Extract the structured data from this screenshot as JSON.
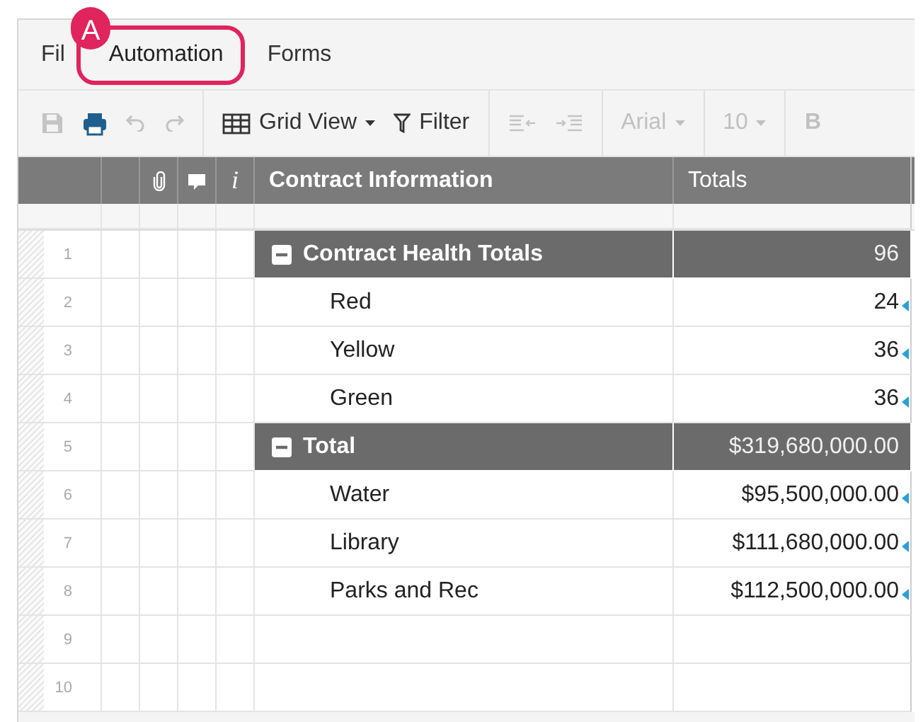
{
  "menu": [
    {
      "label": "Fil",
      "highlighted": false
    },
    {
      "label": "Automation",
      "highlighted": true
    },
    {
      "label": "Forms",
      "highlighted": false
    }
  ],
  "callout": {
    "badge": "A"
  },
  "toolbar": [
    {
      "kind": "save",
      "disabled": true
    },
    {
      "kind": "print",
      "disabled": false
    },
    {
      "kind": "undo",
      "disabled": true
    },
    {
      "kind": "redo",
      "disabled": true
    },
    {
      "kind": "sep"
    },
    {
      "kind": "grid",
      "label": "Grid View",
      "dropdown": true,
      "disabled": false
    },
    {
      "kind": "filter",
      "label": "Filter",
      "disabled": false
    },
    {
      "kind": "sep"
    },
    {
      "kind": "outdent",
      "disabled": true
    },
    {
      "kind": "indent",
      "disabled": true
    },
    {
      "kind": "sep"
    },
    {
      "kind": "text",
      "label": "Arial",
      "dropdown": true,
      "disabled": true
    },
    {
      "kind": "sep"
    },
    {
      "kind": "text",
      "label": "10",
      "dropdown": true,
      "disabled": true
    },
    {
      "kind": "sep"
    },
    {
      "kind": "bold",
      "label": "B",
      "disabled": true
    }
  ],
  "table": {
    "columns": [
      {
        "kind": "attachment"
      },
      {
        "kind": "comment"
      },
      {
        "kind": "info",
        "label": "i"
      },
      {
        "kind": "primary",
        "label": "Contract Information"
      },
      {
        "kind": "totals",
        "label": "Totals"
      }
    ],
    "rows": [
      {
        "number": "1",
        "kind": "parent",
        "expanded": true,
        "name": "Contract Health Totals",
        "total": "96"
      },
      {
        "number": "2",
        "kind": "child",
        "name": "Red",
        "total": "24",
        "linked": true
      },
      {
        "number": "3",
        "kind": "child",
        "name": "Yellow",
        "total": "36",
        "linked": true
      },
      {
        "number": "4",
        "kind": "child",
        "name": "Green",
        "total": "36",
        "linked": true
      },
      {
        "number": "5",
        "kind": "parent",
        "expanded": true,
        "name": "Total",
        "total": "$319,680,000.00"
      },
      {
        "number": "6",
        "kind": "child",
        "name": "Water",
        "total": "$95,500,000.00",
        "linked": true
      },
      {
        "number": "7",
        "kind": "child",
        "name": "Library",
        "total": "$111,680,000.00",
        "linked": true
      },
      {
        "number": "8",
        "kind": "child",
        "name": "Parks and Rec",
        "total": "$112,500,000.00",
        "linked": true
      },
      {
        "number": "9",
        "kind": "empty"
      },
      {
        "number": "10",
        "kind": "empty"
      }
    ]
  }
}
